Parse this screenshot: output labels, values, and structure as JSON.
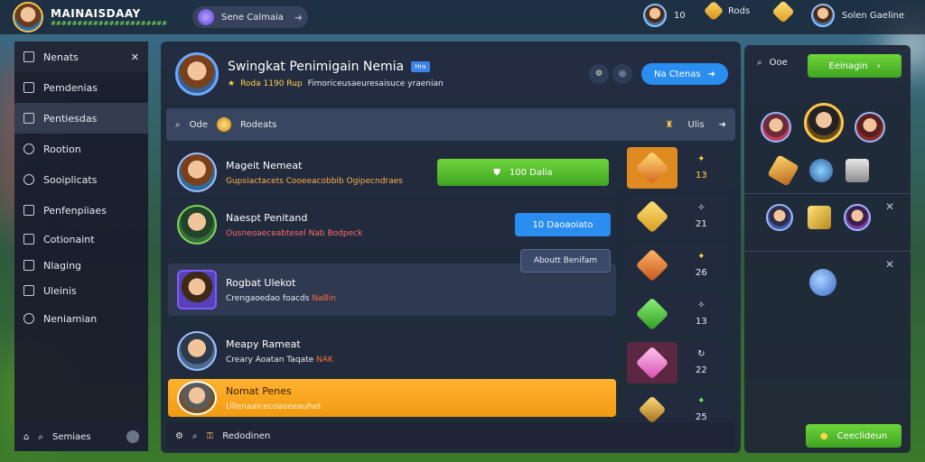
{
  "topbar": {
    "title": "MAINAISDAAY",
    "subtitle": "######################",
    "search_label": "Sene Calmaia",
    "stat1": "10",
    "stat2": "Rods",
    "user_label": "Solen Gaeline"
  },
  "sidebar": {
    "items": [
      {
        "label": "Nenats"
      },
      {
        "label": "Pemdenias"
      },
      {
        "label": "Pentiesdas"
      },
      {
        "label": "Rootion"
      },
      {
        "label": "Sooiplicats"
      },
      {
        "label": "Penfenpiiaes"
      },
      {
        "label": "Cotionaint"
      },
      {
        "label": "Nlaging"
      },
      {
        "label": "Uleinis"
      },
      {
        "label": "Neniamian"
      }
    ],
    "footer_label": "Semiaes"
  },
  "profile": {
    "name": "Swingkat Penimigain Nemia",
    "tag": "Hra",
    "score": "Roda 1190 Rup",
    "desc": "Fimoriceusaeuresaisuce yraenian",
    "action_label": "Na Ctenas"
  },
  "listbar": {
    "left_label": "Ode",
    "label": "Rodeats",
    "right_label": "Ulis"
  },
  "rows": [
    {
      "name": "Mageit Nemeat",
      "desc": "Gupsiactacets Cooeeacobbib Ogipecndraes",
      "highlight": "",
      "button": "100 Dalia"
    },
    {
      "name": "Naespt Penitand",
      "desc": "Ousneoaeceabtesel Nab Bodpeck",
      "highlight": "",
      "button": "10 Daoaoiato"
    },
    {
      "name": "Rogbat Ulekot",
      "desc": "Crengaoedao foacds",
      "highlight": "NaBin",
      "button": "Aboutt Benifam"
    },
    {
      "name": "Meapy Rameat",
      "desc": "Creary Aoatan Taqate",
      "highlight": "NAK",
      "button": ""
    },
    {
      "name": "Nomat Penes",
      "desc": "Ullenaaicecoaoeeauhet",
      "highlight": "",
      "button": ""
    }
  ],
  "ranks": [
    {
      "value": "13"
    },
    {
      "value": "21"
    },
    {
      "value": "26"
    },
    {
      "value": "13"
    },
    {
      "value": "22"
    },
    {
      "value": "25"
    }
  ],
  "main_footer": {
    "label": "Redodinen"
  },
  "right_panel": {
    "search_label": "Ooe",
    "button_label": "Eeinagin",
    "footer_button": "Ceeclideun"
  }
}
